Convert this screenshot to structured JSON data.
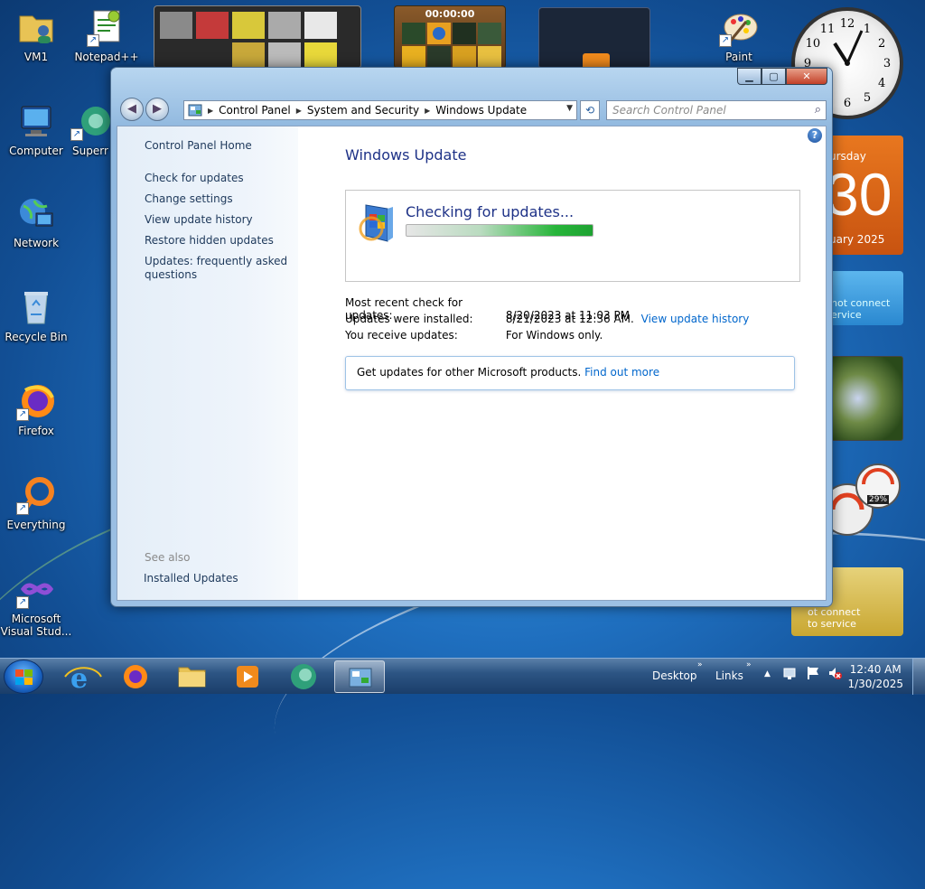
{
  "desktop": {
    "icons": [
      {
        "label": "VM1"
      },
      {
        "label": "Notepad++"
      },
      {
        "label": "Computer"
      },
      {
        "label": "Superr"
      },
      {
        "label": "Network"
      },
      {
        "label": "Recycle Bin"
      },
      {
        "label": "Firefox"
      },
      {
        "label": "Everything"
      },
      {
        "label": "Microsoft Visual Stud..."
      },
      {
        "label": "Paint"
      }
    ]
  },
  "gadgets": {
    "puzzle_timer": "00:00:00",
    "calendar": {
      "day": "ursday",
      "date": "30",
      "month": "uary 2025"
    },
    "weather1_text": "not connect\nervice",
    "meter_percent": "29%",
    "weather2_text": "ot connect\nto service",
    "clock_numbers": [
      "12",
      "1",
      "2",
      "3",
      "4",
      "5",
      "6",
      "7",
      "8",
      "9",
      "10",
      "11"
    ]
  },
  "window": {
    "breadcrumb": [
      "Control Panel",
      "System and Security",
      "Windows Update"
    ],
    "search_placeholder": "Search Control Panel",
    "left_nav": {
      "home": "Control Panel Home",
      "items": [
        "Check for updates",
        "Change settings",
        "View update history",
        "Restore hidden updates",
        "Updates: frequently asked questions"
      ],
      "see_also_heading": "See also",
      "see_also_items": [
        "Installed Updates"
      ]
    },
    "main": {
      "title": "Windows Update",
      "status_text": "Checking for updates...",
      "progress": 1.0,
      "info": [
        {
          "label": "Most recent check for updates:",
          "value": "8/20/2023 at 11:03 PM",
          "link": ""
        },
        {
          "label": "Updates were installed:",
          "value": "8/21/2023 at 12:36 AM.",
          "link": "View update history"
        },
        {
          "label": "You receive updates:",
          "value": "For Windows only.",
          "link": ""
        }
      ],
      "get_updates_text": "Get updates for other Microsoft products.",
      "get_updates_link": "Find out more"
    }
  },
  "taskbar": {
    "toolbars": [
      "Desktop",
      "Links"
    ],
    "time": "12:40 AM",
    "date": "1/30/2025"
  },
  "colors": {
    "accent": "#1e3287",
    "link": "#0066cc",
    "progress": "#27b53a"
  }
}
